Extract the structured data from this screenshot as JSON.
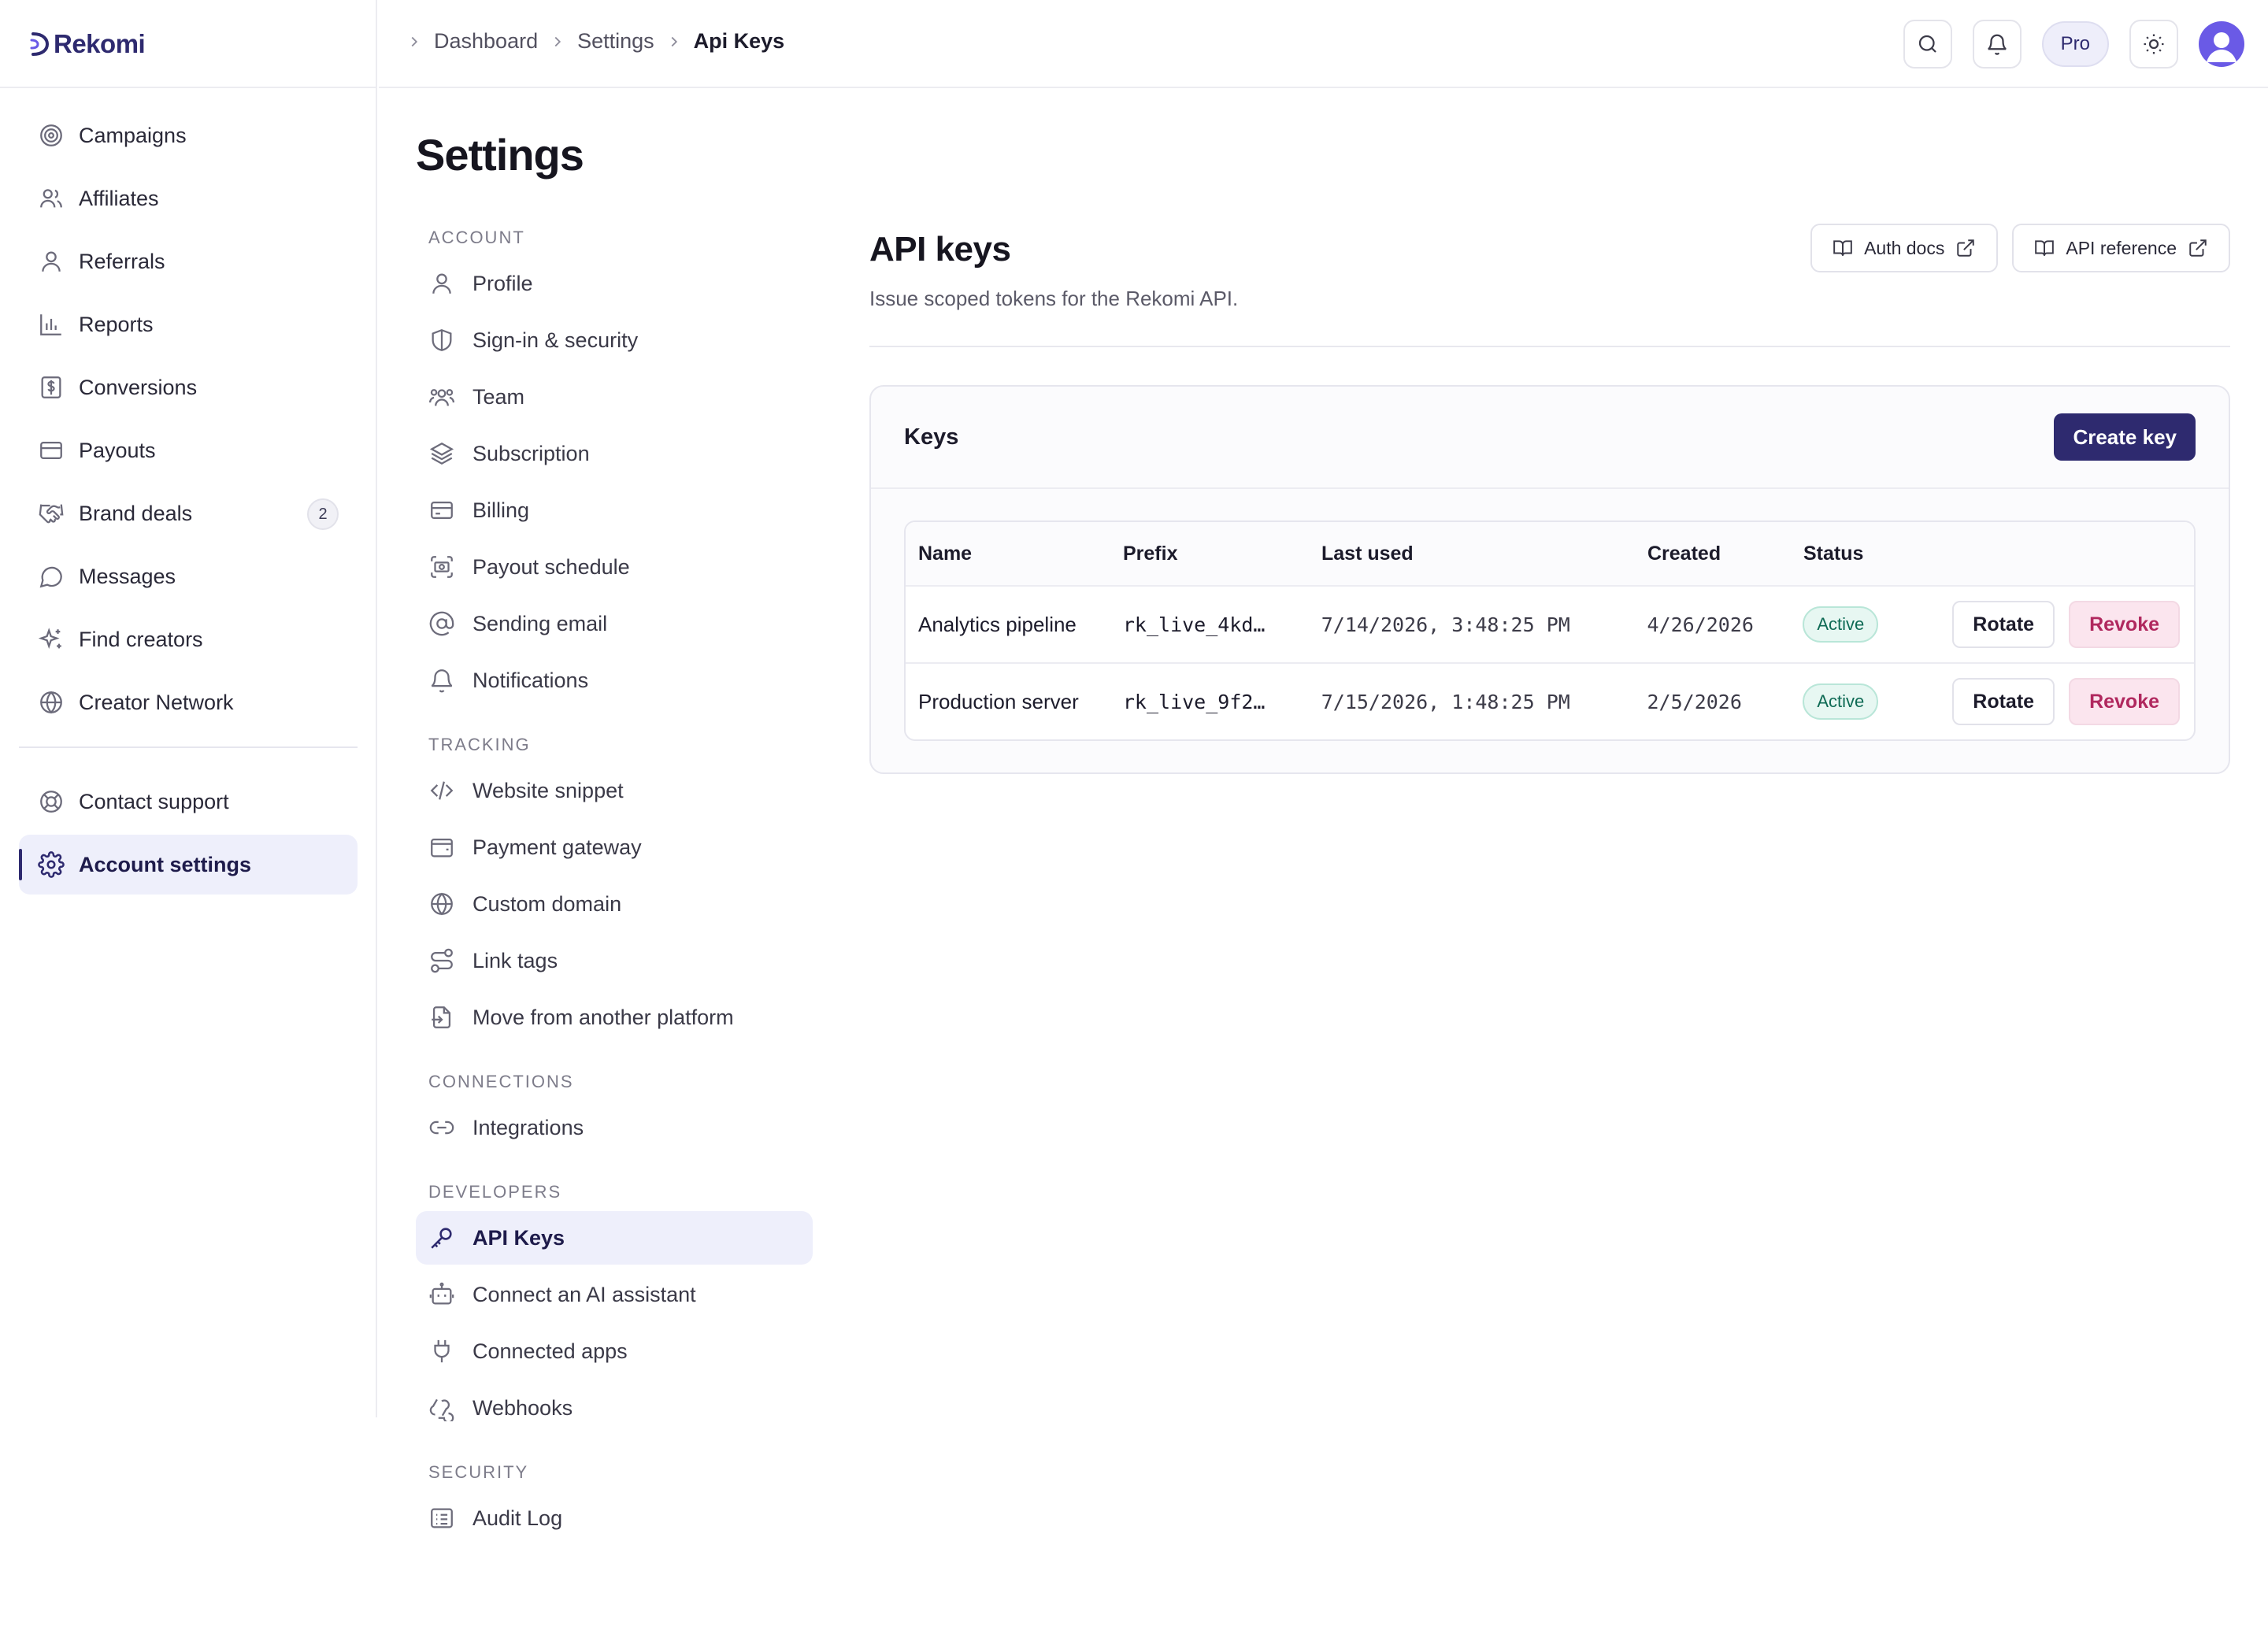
{
  "app": {
    "name": "Rekomi"
  },
  "sidebar": {
    "items": [
      {
        "label": "Campaigns",
        "icon": "target-icon"
      },
      {
        "label": "Affiliates",
        "icon": "users-icon"
      },
      {
        "label": "Referrals",
        "icon": "user-icon"
      },
      {
        "label": "Reports",
        "icon": "bar-chart-icon"
      },
      {
        "label": "Conversions",
        "icon": "dollar-receipt-icon"
      },
      {
        "label": "Payouts",
        "icon": "credit-card-icon"
      },
      {
        "label": "Brand deals",
        "icon": "handshake-icon",
        "badge": "2"
      },
      {
        "label": "Messages",
        "icon": "chat-bubble-icon"
      },
      {
        "label": "Find creators",
        "icon": "sparkles-icon"
      },
      {
        "label": "Creator Network",
        "icon": "globe-icon"
      }
    ],
    "bottom": [
      {
        "label": "Contact support",
        "icon": "lifebuoy-icon"
      },
      {
        "label": "Account settings",
        "icon": "gear-icon",
        "active": true
      }
    ]
  },
  "header": {
    "breadcrumb": [
      "Dashboard",
      "Settings",
      "Api Keys"
    ],
    "plan_badge": "Pro",
    "icons": [
      "search-icon",
      "bell-icon",
      "sun-icon",
      "avatar"
    ]
  },
  "page": {
    "title": "Settings"
  },
  "subnav": {
    "account": {
      "heading": "ACCOUNT",
      "items": [
        {
          "label": "Profile",
          "icon": "user-icon"
        },
        {
          "label": "Sign-in & security",
          "icon": "shield-icon"
        },
        {
          "label": "Team",
          "icon": "users-icon"
        },
        {
          "label": "Subscription",
          "icon": "layers-icon"
        },
        {
          "label": "Billing",
          "icon": "credit-card-icon"
        },
        {
          "label": "Payout schedule",
          "icon": "money-scan-icon"
        },
        {
          "label": "Sending email",
          "icon": "at-sign-icon"
        },
        {
          "label": "Notifications",
          "icon": "bell-icon"
        }
      ]
    },
    "tracking": {
      "heading": "TRACKING",
      "items": [
        {
          "label": "Website snippet",
          "icon": "code-icon"
        },
        {
          "label": "Payment gateway",
          "icon": "wallet-icon"
        },
        {
          "label": "Custom domain",
          "icon": "globe-icon"
        },
        {
          "label": "Link tags",
          "icon": "route-icon"
        },
        {
          "label": "Move from another platform",
          "icon": "file-import-icon"
        }
      ]
    },
    "connections": {
      "heading": "CONNECTIONS",
      "items": [
        {
          "label": "Integrations",
          "icon": "link-icon"
        }
      ]
    },
    "developers": {
      "heading": "DEVELOPERS",
      "items": [
        {
          "label": "API Keys",
          "icon": "key-icon",
          "active": true
        },
        {
          "label": "Connect an AI assistant",
          "icon": "bot-icon"
        },
        {
          "label": "Connected apps",
          "icon": "plug-icon"
        },
        {
          "label": "Webhooks",
          "icon": "webhook-icon"
        }
      ]
    },
    "security": {
      "heading": "SECURITY",
      "items": [
        {
          "label": "Audit Log",
          "icon": "list-icon"
        }
      ]
    }
  },
  "content": {
    "title": "API keys",
    "subtitle": "Issue scoped tokens for the Rekomi API.",
    "links": {
      "auth_docs": "Auth docs",
      "api_reference": "API reference"
    },
    "card": {
      "title": "Keys",
      "create_label": "Create key",
      "columns": {
        "name": "Name",
        "prefix": "Prefix",
        "last_used": "Last used",
        "created": "Created",
        "status": "Status"
      },
      "rows": [
        {
          "name": "Analytics pipeline",
          "prefix": "rk_live_4kd…",
          "last_used": "7/14/2026, 3:48:25 PM",
          "created": "4/26/2026",
          "status": "Active",
          "rotate": "Rotate",
          "revoke": "Revoke"
        },
        {
          "name": "Production server",
          "prefix": "rk_live_9f2…",
          "last_used": "7/15/2026, 1:48:25 PM",
          "created": "2/5/2026",
          "status": "Active",
          "rotate": "Rotate",
          "revoke": "Revoke"
        }
      ]
    }
  }
}
